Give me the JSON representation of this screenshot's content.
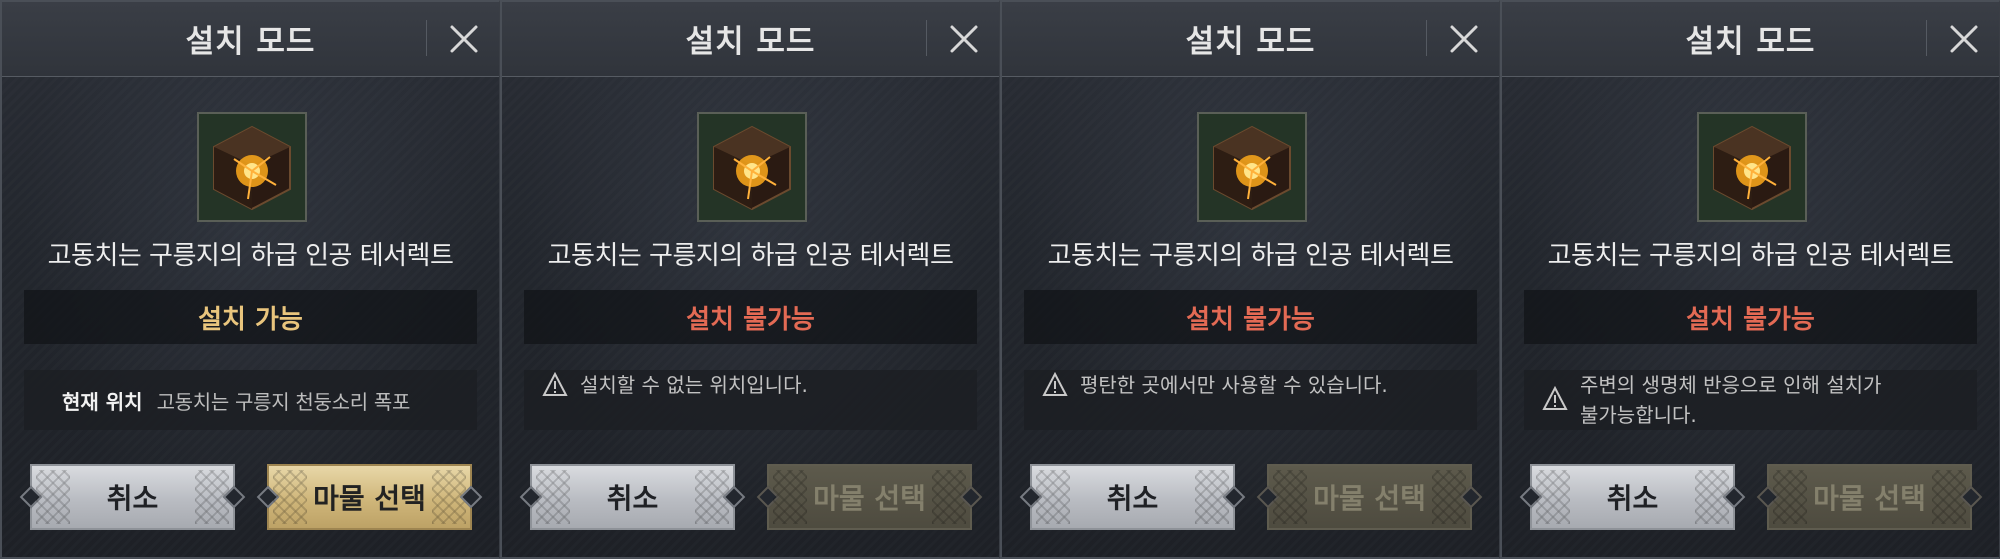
{
  "colors": {
    "status_ok": "#e9c57d",
    "status_bad": "#e36a54",
    "select_enabled": "#cfb67a",
    "select_disabled": "#4e4b3f",
    "cancel": "#c4c7cc"
  },
  "panels": [
    {
      "title": "설치 모드",
      "close_icon": "close-icon",
      "item_icon": "glowing-cube-icon",
      "item_name": "고동치는 구릉지의 하급 인공 테서렉트",
      "status": "설치 가능",
      "status_type": "ok",
      "location_label": "현재 위치",
      "location_value": "고동치는 구릉지  천둥소리 폭포",
      "cancel_label": "취소",
      "select_label": "마물 선택",
      "select_enabled": true
    },
    {
      "title": "설치 모드",
      "close_icon": "close-icon",
      "item_icon": "glowing-cube-icon",
      "item_name": "고동치는 구릉지의 하급 인공 테서렉트",
      "status": "설치 불가능",
      "status_type": "bad",
      "warning_icon": "warning-icon",
      "warning_lines": [
        "설치할 수 없는 위치입니다."
      ],
      "cancel_label": "취소",
      "select_label": "마물 선택",
      "select_enabled": false
    },
    {
      "title": "설치 모드",
      "close_icon": "close-icon",
      "item_icon": "glowing-cube-icon",
      "item_name": "고동치는 구릉지의 하급 인공 테서렉트",
      "status": "설치 불가능",
      "status_type": "bad",
      "warning_icon": "warning-icon",
      "warning_lines": [
        "평탄한 곳에서만 사용할 수 있습니다."
      ],
      "cancel_label": "취소",
      "select_label": "마물 선택",
      "select_enabled": false
    },
    {
      "title": "설치 모드",
      "close_icon": "close-icon",
      "item_icon": "glowing-cube-icon",
      "item_name": "고동치는 구릉지의 하급 인공 테서렉트",
      "status": "설치 불가능",
      "status_type": "bad",
      "warning_icon": "warning-icon",
      "warning_lines": [
        "주변의 생명체 반응으로 인해 설치가",
        "불가능합니다."
      ],
      "cancel_label": "취소",
      "select_label": "마물 선택",
      "select_enabled": false
    }
  ]
}
